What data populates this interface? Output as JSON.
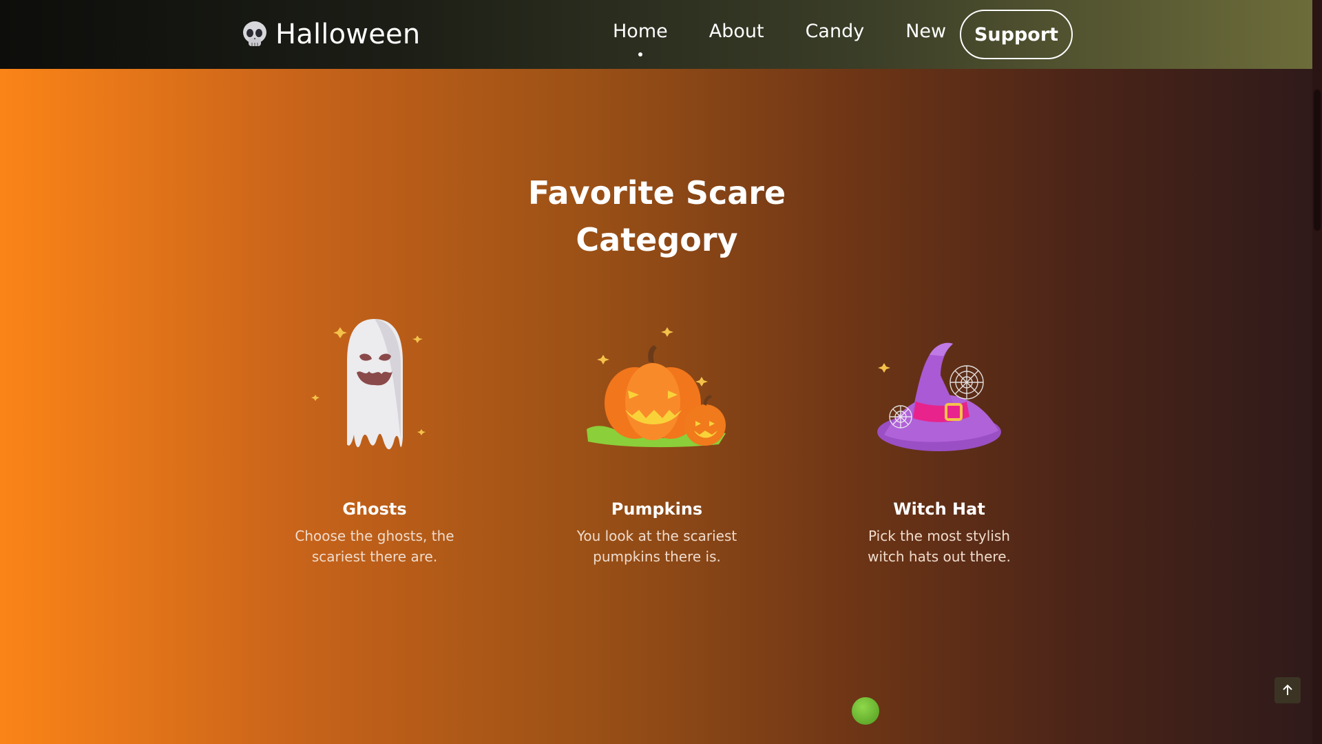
{
  "nav": {
    "brand": "Halloween",
    "links": [
      "Home",
      "About",
      "Candy",
      "New"
    ],
    "active": "Home",
    "support_label": "Support"
  },
  "section": {
    "title_line1": "Favorite Scare",
    "title_line2": "Category"
  },
  "cards": [
    {
      "title": "Ghosts",
      "desc_line1": "Choose the ghosts, the",
      "desc_line2": "scariest there are.",
      "icon": "ghost-icon"
    },
    {
      "title": "Pumpkins",
      "desc_line1": "You look at the scariest",
      "desc_line2": "pumpkins there is.",
      "icon": "pumpkin-icon"
    },
    {
      "title": "Witch Hat",
      "desc_line1": "Pick the most stylish",
      "desc_line2": "witch hats out there.",
      "icon": "witch-hat-icon"
    }
  ],
  "colors": {
    "accent_orange": "#fb8418",
    "dark": "#2e1a1a",
    "nav_dark": "#0d0d0b"
  }
}
